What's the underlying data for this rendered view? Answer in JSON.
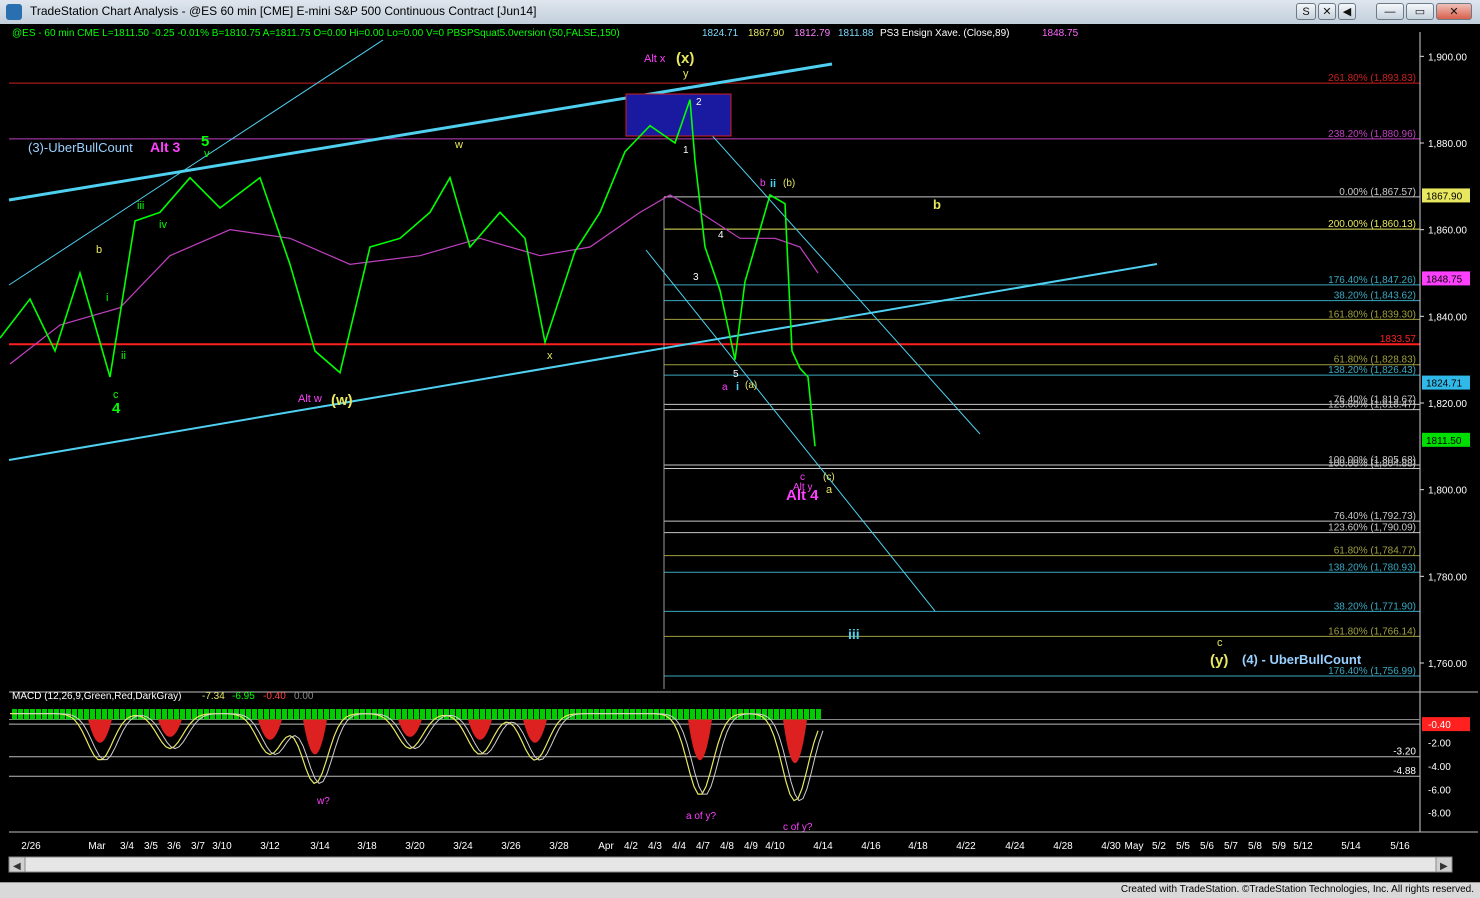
{
  "window": {
    "title": "TradeStation Chart Analysis - @ES 60 min [CME] E-mini S&P 500 Continuous Contract [Jun14]",
    "buttons": [
      "S",
      "✕",
      "◀",
      "—",
      "▭",
      "✕"
    ]
  },
  "footer": "Created with TradeStation. ©TradeStation Technologies, Inc. All rights reserved.",
  "info_bar": [
    {
      "text": "@ES - 60 min   CME   L=1811.50   -0.25   -0.01%   B=1810.75   A=1811.75   O=0.00   Hi=0.00   Lo=0.00   V=0   PBSPSquat5.0version (50,FALSE,150)",
      "color": "#00ff00"
    },
    {
      "text": "1824.71",
      "color": "#7fdcff"
    },
    {
      "text": "1867.90",
      "color": "#e8e860"
    },
    {
      "text": "1812.79",
      "color": "#ff7fff"
    },
    {
      "text": "1811.88",
      "color": "#7fdcff"
    },
    {
      "text": "PS3 Ensign Xave. (Close,89)",
      "color": "#ffffff"
    },
    {
      "text": "1848.75",
      "color": "#ff66ff"
    }
  ],
  "colors": {
    "price": "#00ff00",
    "channel": "#4fd0f0",
    "ma": "#c040c0",
    "axis_bg": "#000000"
  },
  "chart_data": {
    "type": "line",
    "symbol": "@ES",
    "interval": "60 min",
    "ylim": [
      1754,
      1904
    ],
    "y_ticks": [
      "1,900.00",
      "1,880.00",
      "1,860.00",
      "1,840.00",
      "1,820.00",
      "1,800.00",
      "1,780.00",
      "1,760.00"
    ],
    "y_tick_values": [
      1900,
      1880,
      1860,
      1840,
      1820,
      1800,
      1780,
      1760
    ],
    "x_labels": [
      "2/26",
      "Mar",
      "3/4",
      "3/5",
      "3/6",
      "3/7",
      "3/10",
      "3/12",
      "3/14",
      "3/18",
      "3/20",
      "3/24",
      "3/26",
      "3/28",
      "Apr",
      "4/2",
      "4/3",
      "4/4",
      "4/7",
      "4/8",
      "4/9",
      "4/10",
      "4/14",
      "4/16",
      "4/18",
      "4/22",
      "4/24",
      "4/28",
      "4/30",
      "May",
      "5/2",
      "5/5",
      "5/6",
      "5/7",
      "5/8",
      "5/9",
      "5/12",
      "5/14",
      "5/16"
    ],
    "price_series": {
      "name": "@ES",
      "points": [
        [
          0,
          1835
        ],
        [
          30,
          1844
        ],
        [
          55,
          1832
        ],
        [
          80,
          1850
        ],
        [
          110,
          1826
        ],
        [
          135,
          1862
        ],
        [
          160,
          1864
        ],
        [
          190,
          1872
        ],
        [
          220,
          1865
        ],
        [
          260,
          1872
        ],
        [
          290,
          1852
        ],
        [
          315,
          1832
        ],
        [
          340,
          1827
        ],
        [
          370,
          1856
        ],
        [
          400,
          1858
        ],
        [
          430,
          1864
        ],
        [
          450,
          1872
        ],
        [
          470,
          1856
        ],
        [
          500,
          1864
        ],
        [
          525,
          1858
        ],
        [
          545,
          1834
        ],
        [
          575,
          1855
        ],
        [
          600,
          1864
        ],
        [
          625,
          1878
        ],
        [
          650,
          1884
        ],
        [
          675,
          1880
        ],
        [
          690,
          1890
        ],
        [
          695,
          1876
        ],
        [
          705,
          1856
        ],
        [
          720,
          1846
        ],
        [
          735,
          1830
        ],
        [
          745,
          1848
        ],
        [
          770,
          1868
        ],
        [
          785,
          1866
        ],
        [
          792,
          1832
        ],
        [
          800,
          1828
        ],
        [
          808,
          1826
        ],
        [
          815,
          1810
        ]
      ]
    },
    "ma_series": {
      "name": "PS3 Ensign Xave. (Close,89)",
      "points": [
        [
          10,
          1829
        ],
        [
          60,
          1838
        ],
        [
          120,
          1842
        ],
        [
          170,
          1854
        ],
        [
          230,
          1860
        ],
        [
          290,
          1858
        ],
        [
          350,
          1852
        ],
        [
          420,
          1854
        ],
        [
          480,
          1858
        ],
        [
          540,
          1854
        ],
        [
          590,
          1856
        ],
        [
          640,
          1864
        ],
        [
          670,
          1868
        ],
        [
          700,
          1864
        ],
        [
          740,
          1858
        ],
        [
          775,
          1858
        ],
        [
          800,
          1856
        ],
        [
          818,
          1850
        ]
      ]
    },
    "macd": {
      "name": "MACD (12,26,9,Green,Red,DarkGray)",
      "values": [
        "-7.34",
        "-6.95",
        "-0.40",
        "0.00"
      ],
      "y_ticks": [
        "-2.00",
        "-4.00",
        "-6.00",
        "-8.00"
      ],
      "y_tick_values": [
        -2,
        -4,
        -6,
        -8
      ],
      "ylim": [
        -9.5,
        1.5
      ],
      "markers": [
        "-0.40",
        "-3.20",
        "-4.88"
      ],
      "marker_values": [
        -0.4,
        -3.2,
        -4.88
      ],
      "dips": [
        [
          100,
          -4
        ],
        [
          170,
          -3
        ],
        [
          270,
          -3.5
        ],
        [
          315,
          -6
        ],
        [
          410,
          -3
        ],
        [
          480,
          -3.5
        ],
        [
          535,
          -4
        ],
        [
          700,
          -7
        ],
        [
          795,
          -7.5
        ]
      ]
    },
    "fib_levels": [
      {
        "label": "261.80% (1,893.83)",
        "value": 1893.83,
        "color": "#cc2020"
      },
      {
        "label": "238.20% (1,880.96)",
        "value": 1880.96,
        "color": "#c040c0"
      },
      {
        "label": "0.00% (1,867.57)",
        "value": 1867.57,
        "color": "#c8c8c8"
      },
      {
        "label": "200.00% (1,860.13)",
        "value": 1860.13,
        "color": "#e8e860"
      },
      {
        "label": "176.40% (1,847.26)",
        "value": 1847.26,
        "color": "#3aa8c0"
      },
      {
        "label": "38.20% (1,843.62)",
        "value": 1843.62,
        "color": "#3aa8c0"
      },
      {
        "label": "161.80% (1,839.30)",
        "value": 1839.3,
        "color": "#a0a040"
      },
      {
        "label": "1833.57",
        "value": 1833.57,
        "color": "#ff2020"
      },
      {
        "label": "61.80% (1,828.83)",
        "value": 1828.83,
        "color": "#a0a040"
      },
      {
        "label": "138.20% (1,826.43)",
        "value": 1826.43,
        "color": "#3aa8c0"
      },
      {
        "label": "76.40% (1,819.67)",
        "value": 1819.67,
        "color": "#c8c8c8"
      },
      {
        "label": "123.60% (1,818.47)",
        "value": 1818.47,
        "color": "#c8c8c8"
      },
      {
        "label": "100.00% (1,805.68)",
        "value": 1805.68,
        "color": "#c8c8c8"
      },
      {
        "label": "100.00% (1,804.88)",
        "value": 1804.88,
        "color": "#c8c8c8"
      },
      {
        "label": "76.40% (1,792.73)",
        "value": 1792.73,
        "color": "#c8c8c8"
      },
      {
        "label": "123.60% (1,790.09)",
        "value": 1790.09,
        "color": "#c8c8c8"
      },
      {
        "label": "61.80% (1,784.77)",
        "value": 1784.77,
        "color": "#a0a040"
      },
      {
        "label": "138.20% (1,780.93)",
        "value": 1780.93,
        "color": "#3aa8c0"
      },
      {
        "label": "38.20% (1,771.90)",
        "value": 1771.9,
        "color": "#3aa8c0"
      },
      {
        "label": "161.80% (1,766.14)",
        "value": 1766.14,
        "color": "#a0a040"
      },
      {
        "label": "176.40% (1,756.99)",
        "value": 1756.99,
        "color": "#3aa8c0"
      }
    ],
    "price_boxes": [
      {
        "label": "1867.90",
        "value": 1867.9,
        "bg": "#e8e860",
        "fg": "#000000"
      },
      {
        "label": "1848.75",
        "value": 1848.75,
        "bg": "#ff40ff",
        "fg": "#000000"
      },
      {
        "label": "1824.71",
        "value": 1824.71,
        "bg": "#30b8e8",
        "fg": "#000000"
      },
      {
        "label": "1811.50",
        "value": 1811.5,
        "bg": "#00dd00",
        "fg": "#000000"
      }
    ],
    "annotations": [
      {
        "text": "(3)-UberBullCount",
        "color": "#9ad0ff",
        "size": 13,
        "bold": false
      },
      {
        "text": "Alt 3",
        "color": "#ff40ff",
        "size": 14,
        "bold": true
      },
      {
        "text": "5",
        "color": "#00ff00",
        "size": 15,
        "bold": true
      },
      {
        "text": "v",
        "color": "#00ff00",
        "size": 11,
        "bold": false
      },
      {
        "text": "iii",
        "color": "#00ff00",
        "size": 11,
        "bold": false
      },
      {
        "text": "iv",
        "color": "#00ff00",
        "size": 11,
        "bold": false
      },
      {
        "text": "b",
        "color": "#e8e860",
        "size": 11,
        "bold": false
      },
      {
        "text": "i",
        "color": "#00ff00",
        "size": 11,
        "bold": false
      },
      {
        "text": "ii",
        "color": "#00ff00",
        "size": 11,
        "bold": false
      },
      {
        "text": "c",
        "color": "#00ff00",
        "size": 11,
        "bold": false
      },
      {
        "text": "4",
        "color": "#00ff00",
        "size": 15,
        "bold": true
      },
      {
        "text": "Alt w",
        "color": "#ff40ff",
        "size": 11,
        "bold": false
      },
      {
        "text": "(w)",
        "color": "#e8e860",
        "size": 15,
        "bold": true
      },
      {
        "text": "w",
        "color": "#e8e860",
        "size": 11,
        "bold": false
      },
      {
        "text": "x",
        "color": "#e8e860",
        "size": 11,
        "bold": false
      },
      {
        "text": "Alt x",
        "color": "#ff40ff",
        "size": 11,
        "bold": false
      },
      {
        "text": "(x)",
        "color": "#e8e860",
        "size": 15,
        "bold": true
      },
      {
        "text": "y",
        "color": "#e8e860",
        "size": 11,
        "bold": false
      },
      {
        "text": "1",
        "color": "#ffffff",
        "size": 10,
        "bold": false
      },
      {
        "text": "2",
        "color": "#ffffff",
        "size": 10,
        "bold": false
      },
      {
        "text": "3",
        "color": "#ffffff",
        "size": 10,
        "bold": false
      },
      {
        "text": "4",
        "color": "#ffffff",
        "size": 10,
        "bold": false
      },
      {
        "text": "5",
        "color": "#ffffff",
        "size": 10,
        "bold": false
      },
      {
        "text": "a",
        "color": "#ff40ff",
        "size": 10,
        "bold": false
      },
      {
        "text": "i",
        "color": "#4fd0f0",
        "size": 11,
        "bold": true
      },
      {
        "text": "(a)",
        "color": "#e8e860",
        "size": 10,
        "bold": false
      },
      {
        "text": "b",
        "color": "#ff40ff",
        "size": 10,
        "bold": false
      },
      {
        "text": "ii",
        "color": "#4fd0f0",
        "size": 11,
        "bold": true
      },
      {
        "text": "(b)",
        "color": "#e8e860",
        "size": 10,
        "bold": false
      },
      {
        "text": "b",
        "color": "#e8e860",
        "size": 13,
        "bold": true
      },
      {
        "text": "c",
        "color": "#ff40ff",
        "size": 10,
        "bold": false
      },
      {
        "text": "(c)",
        "color": "#e8e860",
        "size": 10,
        "bold": false
      },
      {
        "text": "Alt y",
        "color": "#ff40ff",
        "size": 10,
        "bold": false
      },
      {
        "text": "a",
        "color": "#e8e860",
        "size": 11,
        "bold": false
      },
      {
        "text": "Alt 4",
        "color": "#ff40ff",
        "size": 15,
        "bold": true
      },
      {
        "text": "iii",
        "color": "#4fd0f0",
        "size": 14,
        "bold": true
      },
      {
        "text": "c",
        "color": "#e8e860",
        "size": 11,
        "bold": false
      },
      {
        "text": "(y)",
        "color": "#e8e860",
        "size": 15,
        "bold": true
      },
      {
        "text": "(4) - UberBullCount",
        "color": "#9ad0ff",
        "size": 13,
        "bold": true
      },
      {
        "text": "w?",
        "color": "#ff40ff",
        "size": 10,
        "bold": false
      },
      {
        "text": "a of y?",
        "color": "#ff40ff",
        "size": 10,
        "bold": false
      },
      {
        "text": "c of y?",
        "color": "#ff40ff",
        "size": 10,
        "bold": false
      }
    ]
  }
}
